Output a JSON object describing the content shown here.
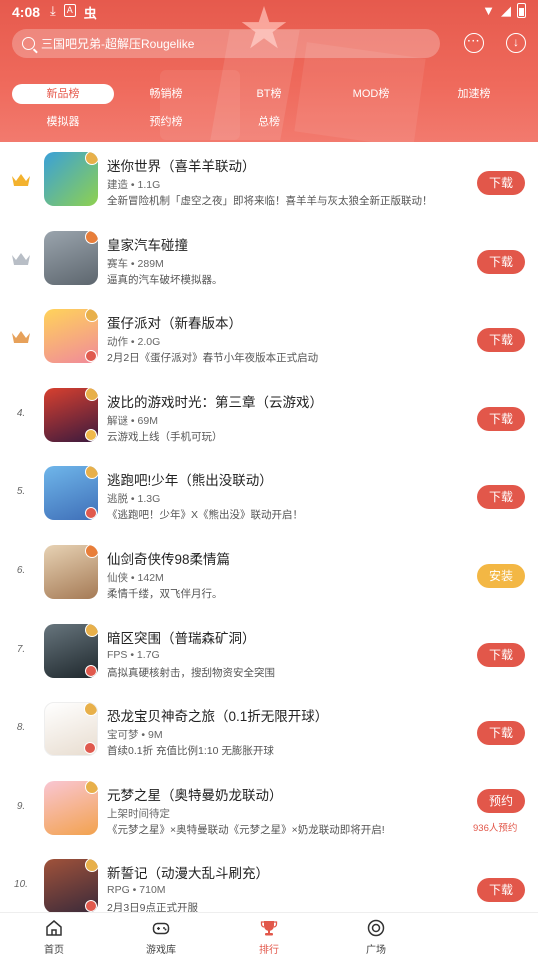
{
  "status_bar": {
    "time": "4:08",
    "left_icons": [
      "download-icon",
      "a-icon",
      "app-icon"
    ],
    "right_icons": [
      "wifi-icon",
      "signal-icon",
      "battery-icon"
    ]
  },
  "header": {
    "search_text": "三国吧兄弟-超解压Rougelike",
    "more_icon": "ellipsis-icon",
    "download_icon": "download-circle-icon"
  },
  "tabs_row1": [
    {
      "label": "新品榜",
      "active": true
    },
    {
      "label": "畅销榜",
      "active": false
    },
    {
      "label": "BT榜",
      "active": false
    },
    {
      "label": "MOD榜",
      "active": false
    },
    {
      "label": "加速榜",
      "active": false
    }
  ],
  "tabs_row2": [
    {
      "label": "模拟器"
    },
    {
      "label": "预约榜"
    },
    {
      "label": "总榜"
    }
  ],
  "items": [
    {
      "rank": "",
      "crown": "gold",
      "name": "迷你世界（喜羊羊联动）",
      "meta": "建造 • 1.1G",
      "desc": "全新冒险机制「虚空之夜」即将来临！喜羊羊与灰太狼全新正版联动！",
      "button": "下载",
      "button_type": "download",
      "note": ""
    },
    {
      "rank": "",
      "crown": "silver",
      "name": "皇家汽车碰撞",
      "meta": "赛车 • 289M",
      "desc": "逼真的汽车破坏模拟器。",
      "button": "下载",
      "button_type": "download",
      "note": ""
    },
    {
      "rank": "",
      "crown": "bronze",
      "name": "蛋仔派对（新春版本）",
      "meta": "动作 • 2.0G",
      "desc": "2月2日《蛋仔派对》春节小年夜版本正式启动",
      "button": "下载",
      "button_type": "download",
      "note": ""
    },
    {
      "rank": "4.",
      "crown": "",
      "name": "波比的游戏时光：第三章（云游戏）",
      "meta": "解谜 • 69M",
      "desc": "云游戏上线（手机可玩）",
      "button": "下载",
      "button_type": "download",
      "note": ""
    },
    {
      "rank": "5.",
      "crown": "",
      "name": "逃跑吧!少年（熊出没联动）",
      "meta": "逃脱 • 1.3G",
      "desc": "《逃跑吧！少年》X《熊出没》联动开启！",
      "button": "下载",
      "button_type": "download",
      "note": ""
    },
    {
      "rank": "6.",
      "crown": "",
      "name": "仙剑奇侠传98柔情篇",
      "meta": "仙侠 • 142M",
      "desc": "柔情千缕，双飞伴月行。",
      "button": "安装",
      "button_type": "install",
      "note": ""
    },
    {
      "rank": "7.",
      "crown": "",
      "name": "暗区突围（普瑞森矿洞）",
      "meta": "FPS • 1.7G",
      "desc": "高拟真硬核射击，搜刮物资安全突围",
      "button": "下载",
      "button_type": "download",
      "note": ""
    },
    {
      "rank": "8.",
      "crown": "",
      "name": "恐龙宝贝神奇之旅（0.1折无限开球）",
      "meta": "宝可梦 • 9M",
      "desc": "首续0.1折 充值比例1:10 无膨胀开球",
      "button": "下载",
      "button_type": "download",
      "note": ""
    },
    {
      "rank": "9.",
      "crown": "",
      "name": "元梦之星（奥特曼奶龙联动）",
      "meta": "上架时间待定",
      "desc": "《元梦之星》×奥特曼联动《元梦之星》×奶龙联动即将开启!",
      "button": "预约",
      "button_type": "reserve",
      "note": "936人预约"
    },
    {
      "rank": "10.",
      "crown": "",
      "name": "新誓记（动漫大乱斗刷充）",
      "meta": "RPG • 710M",
      "desc": "2月3日9点正式开服",
      "button": "下载",
      "button_type": "download",
      "note": ""
    }
  ],
  "icon_colors": [
    "#3aa0d8",
    "#7f8a93",
    "#f0b94a",
    "#c23a2c",
    "#4b7ac2",
    "#c8a27a",
    "#39454c",
    "#f4f0ea",
    "#f7b2c2",
    "#8a4b3a"
  ],
  "bottom_nav": [
    {
      "label": "首页",
      "icon": "home-icon",
      "active": false
    },
    {
      "label": "游戏库",
      "icon": "gamepad-icon",
      "active": false
    },
    {
      "label": "排行",
      "icon": "trophy-icon",
      "active": true
    },
    {
      "label": "广场",
      "icon": "plaza-icon",
      "active": false
    }
  ],
  "colors": {
    "accent": "#e2574a",
    "install": "#f3b744",
    "header": "#e65a4d"
  }
}
